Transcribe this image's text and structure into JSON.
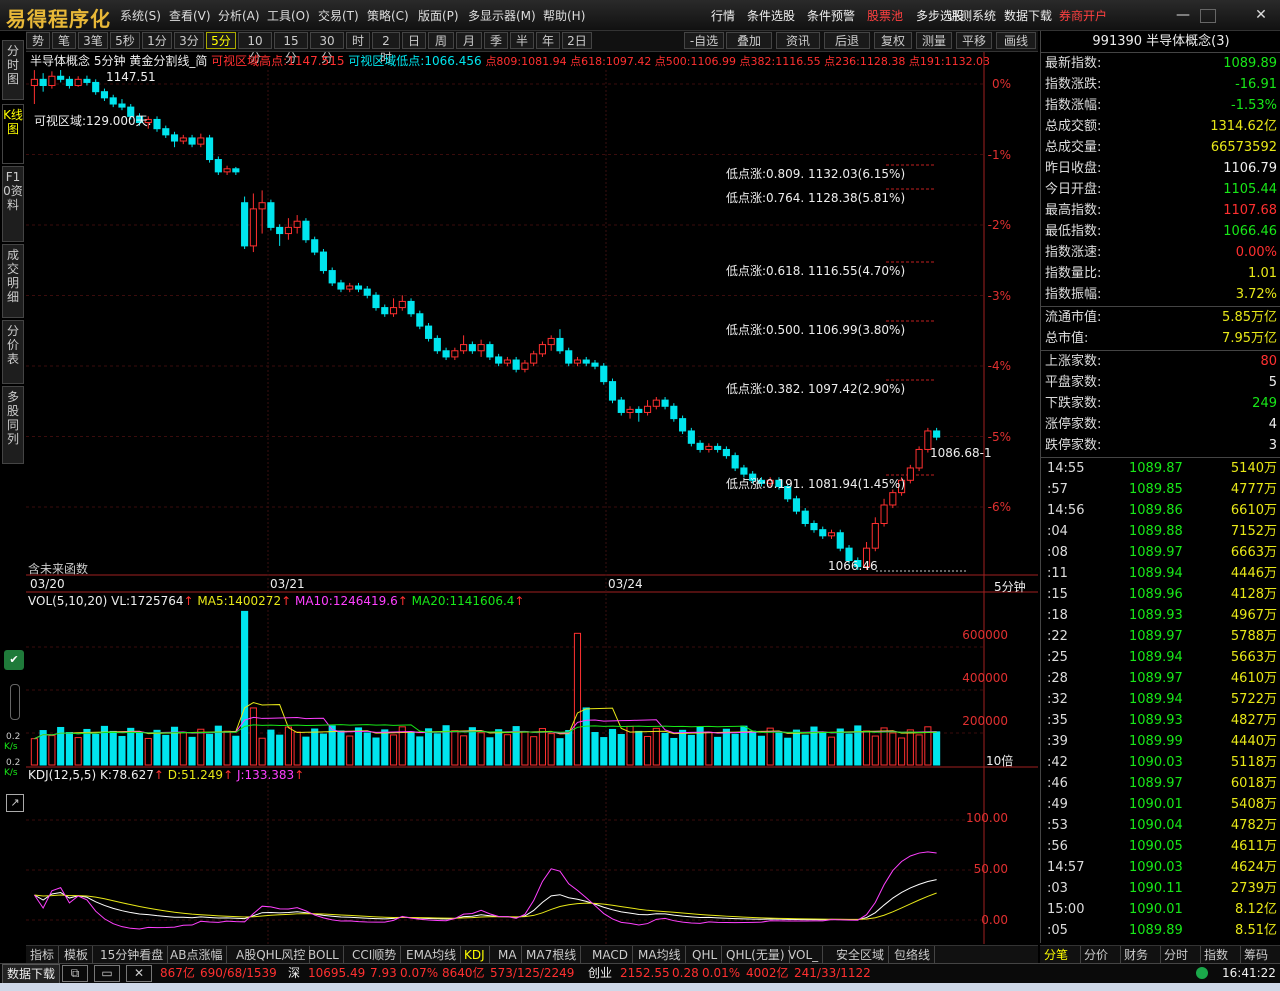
{
  "menubar": {
    "logo": "易得程序化",
    "items": [
      "系统(S)",
      "查看(V)",
      "分析(A)",
      "工具(O)",
      "交易(T)",
      "策略(C)",
      "版面(P)",
      "多显示器(M)",
      "帮助(H)"
    ],
    "right_items": [
      "行情",
      "条件选股",
      "条件预警",
      "股票池",
      "多步选股",
      "评测系统",
      "数据下载",
      "券商开户"
    ]
  },
  "periods": [
    "势",
    "笔",
    "3笔",
    "5秒",
    "1分",
    "3分",
    "5分",
    "10分",
    "15分",
    "30分",
    "时",
    "2时",
    "日",
    "周",
    "月",
    "季",
    "半",
    "年",
    "2日"
  ],
  "active_period": "5分",
  "tools": [
    "-自选",
    "叠加",
    "资讯",
    "后退",
    "复权",
    "测量",
    "平移",
    "画线"
  ],
  "vtabs": [
    "分时图",
    "K线图",
    "F10资料",
    "成交明细",
    "分价表",
    "多股同列"
  ],
  "chart": {
    "header_name": "半导体概念",
    "header_period": "5分钟",
    "header_study": "黄金分割线_简",
    "visible_high": "可视区域高点:1147.515",
    "visible_low": "可视区域低点:1066.456",
    "points": "点809:1081.94 点618:1097.42 点500:1106.99 点382:1116.55 点236:1128.38 点191:1132.03",
    "visible_days": "可视区域:129.000天.",
    "top_price": "1147.51",
    "low_price": "1066.46",
    "last_price": "1086.68-1",
    "future_fn": "含未来函数",
    "period_label": "5分钟",
    "dates": [
      "03/20",
      "03/21",
      "03/24"
    ],
    "ylabels": [
      "0%",
      "-1%",
      "-2%",
      "-3%",
      "-4%",
      "-5%",
      "-6%"
    ],
    "fib": [
      "低点涨:0.809. 1132.03(6.15%)",
      "低点涨:0.764. 1128.38(5.81%)",
      "低点涨:0.618. 1116.55(4.70%)",
      "低点涨:0.500. 1106.99(3.80%)",
      "低点涨:0.382. 1097.42(2.90%)",
      "低点涨:0.191. 1081.94(1.45%)"
    ]
  },
  "chart_data": {
    "type": "candlestick",
    "title": "半导体概念 5分钟",
    "ylim": [
      1066.46,
      1147.515
    ],
    "candles": [
      [
        1145,
        1146,
        1142,
        1147.5
      ],
      [
        1146,
        1145,
        1144,
        1147
      ],
      [
        1145,
        1146.5,
        1144.5,
        1147.3
      ],
      [
        1146.5,
        1146,
        1145.5,
        1147.51
      ],
      [
        1146,
        1145,
        1144.5,
        1146.5
      ],
      [
        1145,
        1146,
        1144.8,
        1146.5
      ],
      [
        1146,
        1145.5,
        1145,
        1146.6
      ],
      [
        1145.5,
        1144,
        1143.5,
        1146
      ],
      [
        1144,
        1143,
        1142.5,
        1144.5
      ],
      [
        1143,
        1142,
        1141.5,
        1143.5
      ],
      [
        1142,
        1141.5,
        1141,
        1142.8
      ],
      [
        1141.5,
        1140,
        1139.5,
        1142
      ],
      [
        1140,
        1139,
        1138.5,
        1140.5
      ],
      [
        1139,
        1139.5,
        1138,
        1140
      ],
      [
        1139.5,
        1138,
        1137.5,
        1140
      ],
      [
        1138,
        1137,
        1136.5,
        1138.5
      ],
      [
        1137,
        1136,
        1135,
        1137.5
      ],
      [
        1136,
        1136.5,
        1135.5,
        1137
      ],
      [
        1136.5,
        1135.5,
        1135,
        1137
      ],
      [
        1135.5,
        1136.5,
        1135,
        1137.2
      ],
      [
        1136.5,
        1133,
        1132.5,
        1137
      ],
      [
        1133,
        1131,
        1130.5,
        1133.5
      ],
      [
        1131,
        1131.5,
        1130.5,
        1132
      ],
      [
        1131.5,
        1131,
        1130.5,
        1131.8
      ],
      [
        1126,
        1119,
        1118.5,
        1127
      ],
      [
        1119,
        1125,
        1118,
        1127.5
      ],
      [
        1125,
        1126,
        1121,
        1128
      ],
      [
        1126,
        1122,
        1121.5,
        1126.5
      ],
      [
        1122,
        1121,
        1119,
        1122.5
      ],
      [
        1121,
        1122,
        1120,
        1123.5
      ],
      [
        1122,
        1123,
        1121,
        1124
      ],
      [
        1123,
        1120,
        1119.5,
        1123.5
      ],
      [
        1120,
        1118,
        1117.5,
        1120.5
      ],
      [
        1118,
        1115,
        1114.5,
        1118.5
      ],
      [
        1115,
        1113,
        1112.5,
        1115.5
      ],
      [
        1113,
        1112,
        1111.5,
        1113.5
      ],
      [
        1112,
        1112.5,
        1111.5,
        1113
      ],
      [
        1112.5,
        1112,
        1111.5,
        1113
      ],
      [
        1112,
        1111,
        1110.5,
        1112.5
      ],
      [
        1111,
        1109,
        1108.5,
        1111.5
      ],
      [
        1109,
        1108,
        1107.5,
        1109.5
      ],
      [
        1108,
        1109,
        1107.5,
        1110.5
      ],
      [
        1109,
        1110,
        1108.5,
        1111
      ],
      [
        1110,
        1108,
        1107.5,
        1110.5
      ],
      [
        1108,
        1106,
        1105.5,
        1108.5
      ],
      [
        1106,
        1104,
        1103.5,
        1106.5
      ],
      [
        1104,
        1102,
        1101.5,
        1104.5
      ],
      [
        1102,
        1101,
        1100.5,
        1102.5
      ],
      [
        1101,
        1102,
        1100.5,
        1102.5
      ],
      [
        1102,
        1103,
        1101.5,
        1104.5
      ],
      [
        1103,
        1102,
        1101.5,
        1103.5
      ],
      [
        1102,
        1103,
        1101,
        1103.8
      ],
      [
        1103,
        1101,
        1100.5,
        1103.5
      ],
      [
        1101,
        1100,
        1099.5,
        1101.5
      ],
      [
        1100,
        1100.5,
        1099.5,
        1101
      ],
      [
        1100.5,
        1099,
        1098.5,
        1101
      ],
      [
        1099,
        1100,
        1098.5,
        1100.5
      ],
      [
        1100,
        1101.5,
        1099.5,
        1102
      ],
      [
        1101.5,
        1103,
        1101,
        1103.5
      ],
      [
        1103,
        1104,
        1102,
        1104.5
      ],
      [
        1104,
        1102,
        1101.5,
        1105.5
      ],
      [
        1102,
        1100,
        1099.5,
        1102.5
      ],
      [
        1100,
        1100.5,
        1099.5,
        1101
      ],
      [
        1100.5,
        1100,
        1099.5,
        1101
      ],
      [
        1100,
        1099.5,
        1099,
        1100.5
      ],
      [
        1099.5,
        1097,
        1096.5,
        1100
      ],
      [
        1097,
        1094,
        1093.5,
        1097.5
      ],
      [
        1094,
        1092,
        1091.5,
        1094.5
      ],
      [
        1092,
        1092.5,
        1091,
        1093
      ],
      [
        1092.5,
        1092,
        1090.5,
        1093
      ],
      [
        1092,
        1093,
        1091.5,
        1094
      ],
      [
        1093,
        1094,
        1092.5,
        1094.5
      ],
      [
        1094,
        1093,
        1092.5,
        1094.5
      ],
      [
        1093,
        1091,
        1090.5,
        1093.5
      ],
      [
        1091,
        1089,
        1088.5,
        1091.5
      ],
      [
        1089,
        1087,
        1086.5,
        1089.5
      ],
      [
        1087,
        1086,
        1085.5,
        1087.5
      ],
      [
        1086,
        1086.5,
        1085.5,
        1087
      ],
      [
        1086.5,
        1086,
        1085.5,
        1087
      ],
      [
        1086,
        1085,
        1084.5,
        1086.5
      ],
      [
        1085,
        1083,
        1082.5,
        1085.5
      ],
      [
        1083,
        1082,
        1081.5,
        1083.5
      ],
      [
        1082,
        1081,
        1080.5,
        1082.5
      ],
      [
        1081,
        1080.5,
        1080,
        1081.5
      ],
      [
        1080.5,
        1081,
        1080,
        1081.5
      ],
      [
        1081,
        1080,
        1079.5,
        1081.5
      ],
      [
        1080,
        1078,
        1077.5,
        1080.5
      ],
      [
        1078,
        1076,
        1075.5,
        1078.5
      ],
      [
        1076,
        1074,
        1073.5,
        1076.5
      ],
      [
        1074,
        1073,
        1072.5,
        1074.5
      ],
      [
        1073,
        1072,
        1071.5,
        1073.5
      ],
      [
        1072,
        1072.5,
        1071.5,
        1073
      ],
      [
        1072.5,
        1070,
        1069.5,
        1073
      ],
      [
        1070,
        1068,
        1067.5,
        1070.5
      ],
      [
        1068,
        1067,
        1066.46,
        1068.5
      ],
      [
        1067,
        1070,
        1066.5,
        1071
      ],
      [
        1070,
        1074,
        1069.5,
        1075
      ],
      [
        1074,
        1077,
        1073.5,
        1078
      ],
      [
        1077,
        1079,
        1076.5,
        1079.5
      ],
      [
        1079,
        1081,
        1078.5,
        1081.5
      ],
      [
        1081,
        1083,
        1080.5,
        1083.5
      ],
      [
        1083,
        1086,
        1082.5,
        1086.5
      ],
      [
        1086,
        1089,
        1085.5,
        1089.5
      ],
      [
        1089,
        1088,
        1087.5,
        1089.5
      ]
    ],
    "volume_ylabels": [
      "600000",
      "400000",
      "200000"
    ],
    "kdj_ylabels": [
      "100.00",
      "50.00",
      "0.00"
    ]
  },
  "vol_header": {
    "label": "VOL(5,10,20) VL:1725764",
    "ma5": "MA5:1400272",
    "ma10": "MA10:1246419.6",
    "ma20": "MA20:1141606.4",
    "scale": "10倍"
  },
  "kdj_header": {
    "label": "KDJ(12,5,5) K:78.627",
    "d": "D:51.249",
    "j": "J:133.383"
  },
  "left_misc": [
    "0.2",
    "K/s",
    "0.2",
    "K/s"
  ],
  "right": {
    "title": "991390 半导体概念(3)",
    "rows": [
      {
        "k": "最新指数:",
        "v": "1089.89",
        "c": "green"
      },
      {
        "k": "指数涨跌:",
        "v": "-16.91",
        "c": "green"
      },
      {
        "k": "指数涨幅:",
        "v": "-1.53%",
        "c": "green"
      },
      {
        "k": "总成交额:",
        "v": "1314.62亿",
        "c": "yellow"
      },
      {
        "k": "总成交量:",
        "v": "66573592",
        "c": "yellow"
      },
      {
        "k": "昨日收盘:",
        "v": "1106.79",
        "c": "white"
      },
      {
        "k": "今日开盘:",
        "v": "1105.44",
        "c": "green"
      },
      {
        "k": "最高指数:",
        "v": "1107.68",
        "c": "red"
      },
      {
        "k": "最低指数:",
        "v": "1066.46",
        "c": "green"
      },
      {
        "k": "指数涨速:",
        "v": "0.00%",
        "c": "red"
      },
      {
        "k": "指数量比:",
        "v": "1.01",
        "c": "yellow"
      },
      {
        "k": "指数振幅:",
        "v": "3.72%",
        "c": "yellow"
      }
    ],
    "rows2": [
      {
        "k": "流通市值:",
        "v": "5.85万亿",
        "c": "yellow"
      },
      {
        "k": "总市值:",
        "v": "7.95万亿",
        "c": "yellow"
      }
    ],
    "rows3": [
      {
        "k": "上涨家数:",
        "v": "80",
        "c": "red"
      },
      {
        "k": "平盘家数:",
        "v": "5",
        "c": "white"
      },
      {
        "k": "下跌家数:",
        "v": "249",
        "c": "green"
      },
      {
        "k": "涨停家数:",
        "v": "4",
        "c": "white"
      },
      {
        "k": "跌停家数:",
        "v": "3",
        "c": "white"
      }
    ],
    "ticks": [
      {
        "t": "14:55",
        "p": "1089.87",
        "q": "5140万"
      },
      {
        "t": ":57",
        "p": "1089.85",
        "q": "4777万"
      },
      {
        "t": "14:56",
        "p": "1089.86",
        "q": "6610万"
      },
      {
        "t": ":04",
        "p": "1089.88",
        "q": "7152万"
      },
      {
        "t": ":08",
        "p": "1089.97",
        "q": "6663万"
      },
      {
        "t": ":11",
        "p": "1089.94",
        "q": "4446万"
      },
      {
        "t": ":15",
        "p": "1089.96",
        "q": "4128万"
      },
      {
        "t": ":18",
        "p": "1089.93",
        "q": "4967万"
      },
      {
        "t": ":22",
        "p": "1089.97",
        "q": "5788万"
      },
      {
        "t": ":25",
        "p": "1089.94",
        "q": "5663万"
      },
      {
        "t": ":28",
        "p": "1089.97",
        "q": "4610万"
      },
      {
        "t": ":32",
        "p": "1089.94",
        "q": "5722万"
      },
      {
        "t": ":35",
        "p": "1089.93",
        "q": "4827万"
      },
      {
        "t": ":39",
        "p": "1089.99",
        "q": "4440万"
      },
      {
        "t": ":42",
        "p": "1090.03",
        "q": "5118万"
      },
      {
        "t": ":46",
        "p": "1089.97",
        "q": "6018万"
      },
      {
        "t": ":49",
        "p": "1090.01",
        "q": "5408万"
      },
      {
        "t": ":53",
        "p": "1090.04",
        "q": "4782万"
      },
      {
        "t": ":56",
        "p": "1090.05",
        "q": "4611万"
      },
      {
        "t": "14:57",
        "p": "1090.03",
        "q": "4624万"
      },
      {
        "t": ":03",
        "p": "1090.11",
        "q": "2739万"
      },
      {
        "t": "15:00",
        "p": "1090.01",
        "q": "8.12亿"
      },
      {
        "t": ":05",
        "p": "1089.89",
        "q": "8.51亿"
      }
    ]
  },
  "bottom_tabs": [
    "指标",
    "模板",
    "15分钟看盘",
    "AB点涨幅",
    "A股QHL风控",
    "BOLL",
    "CCI顺势",
    "EMA均线",
    "KDJ",
    "MA",
    "MA7根线",
    "MACD",
    "MA均线",
    "QHL",
    "QHL(无量)",
    "VOL_",
    "安全区域",
    "包络线"
  ],
  "active_bottom_tab": "KDJ",
  "right_tabs": [
    "分笔",
    "分价",
    "财务",
    "分时",
    "指数",
    "筹码"
  ],
  "status": {
    "download": "数据下载",
    "sh_tail": "867亿",
    "sh_counts": "690/68/1539",
    "sz_label": "深",
    "sz_index": "10695.49",
    "sz_chg": "7.93",
    "sz_pct": "0.07%",
    "sz_amt": "8640亿",
    "sz_counts": "573/125/2249",
    "cy_label": "创业",
    "cy_index": "2152.55",
    "cy_chg": "0.28",
    "cy_pct": "0.01%",
    "cy_amt": "4002亿",
    "cy_counts": "241/33/1122",
    "time": "16:41:22"
  }
}
